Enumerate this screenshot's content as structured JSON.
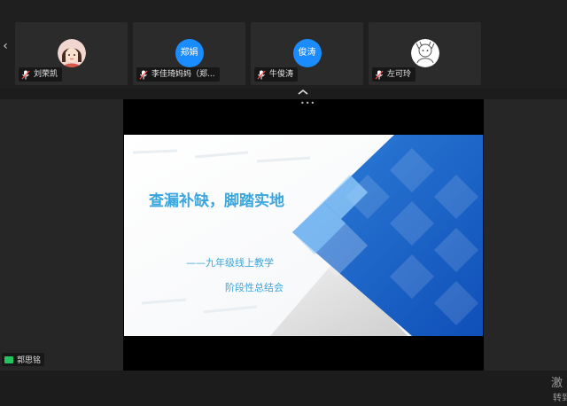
{
  "participants": [
    {
      "name": "刘荣凯",
      "avatar_type": "photo-girl"
    },
    {
      "name": "李佳琦妈妈（郑...",
      "avatar_text": "郑娟",
      "avatar_color": "#1a8cff"
    },
    {
      "name": "牛俊涛",
      "avatar_text": "俊涛",
      "avatar_color": "#1a8cff"
    },
    {
      "name": "左可玲",
      "avatar_type": "sketch"
    }
  ],
  "stage": {
    "more_dots": "•••",
    "slide": {
      "title": "查漏补缺，脚踏实地",
      "subtitle_line1": "——九年级线上教学",
      "subtitle_line2": "阶段性总结会",
      "accent_color": "#3aa6dd"
    }
  },
  "self_view": {
    "name": "郭思铭",
    "camera_color": "#23c45e"
  },
  "watermark": {
    "line1": "激",
    "line2": "转到"
  },
  "icons": {
    "prev": "chevron-left-icon",
    "collapse": "chevron-up-icon",
    "mic": "microphone-muted-icon",
    "camera": "camera-icon"
  }
}
